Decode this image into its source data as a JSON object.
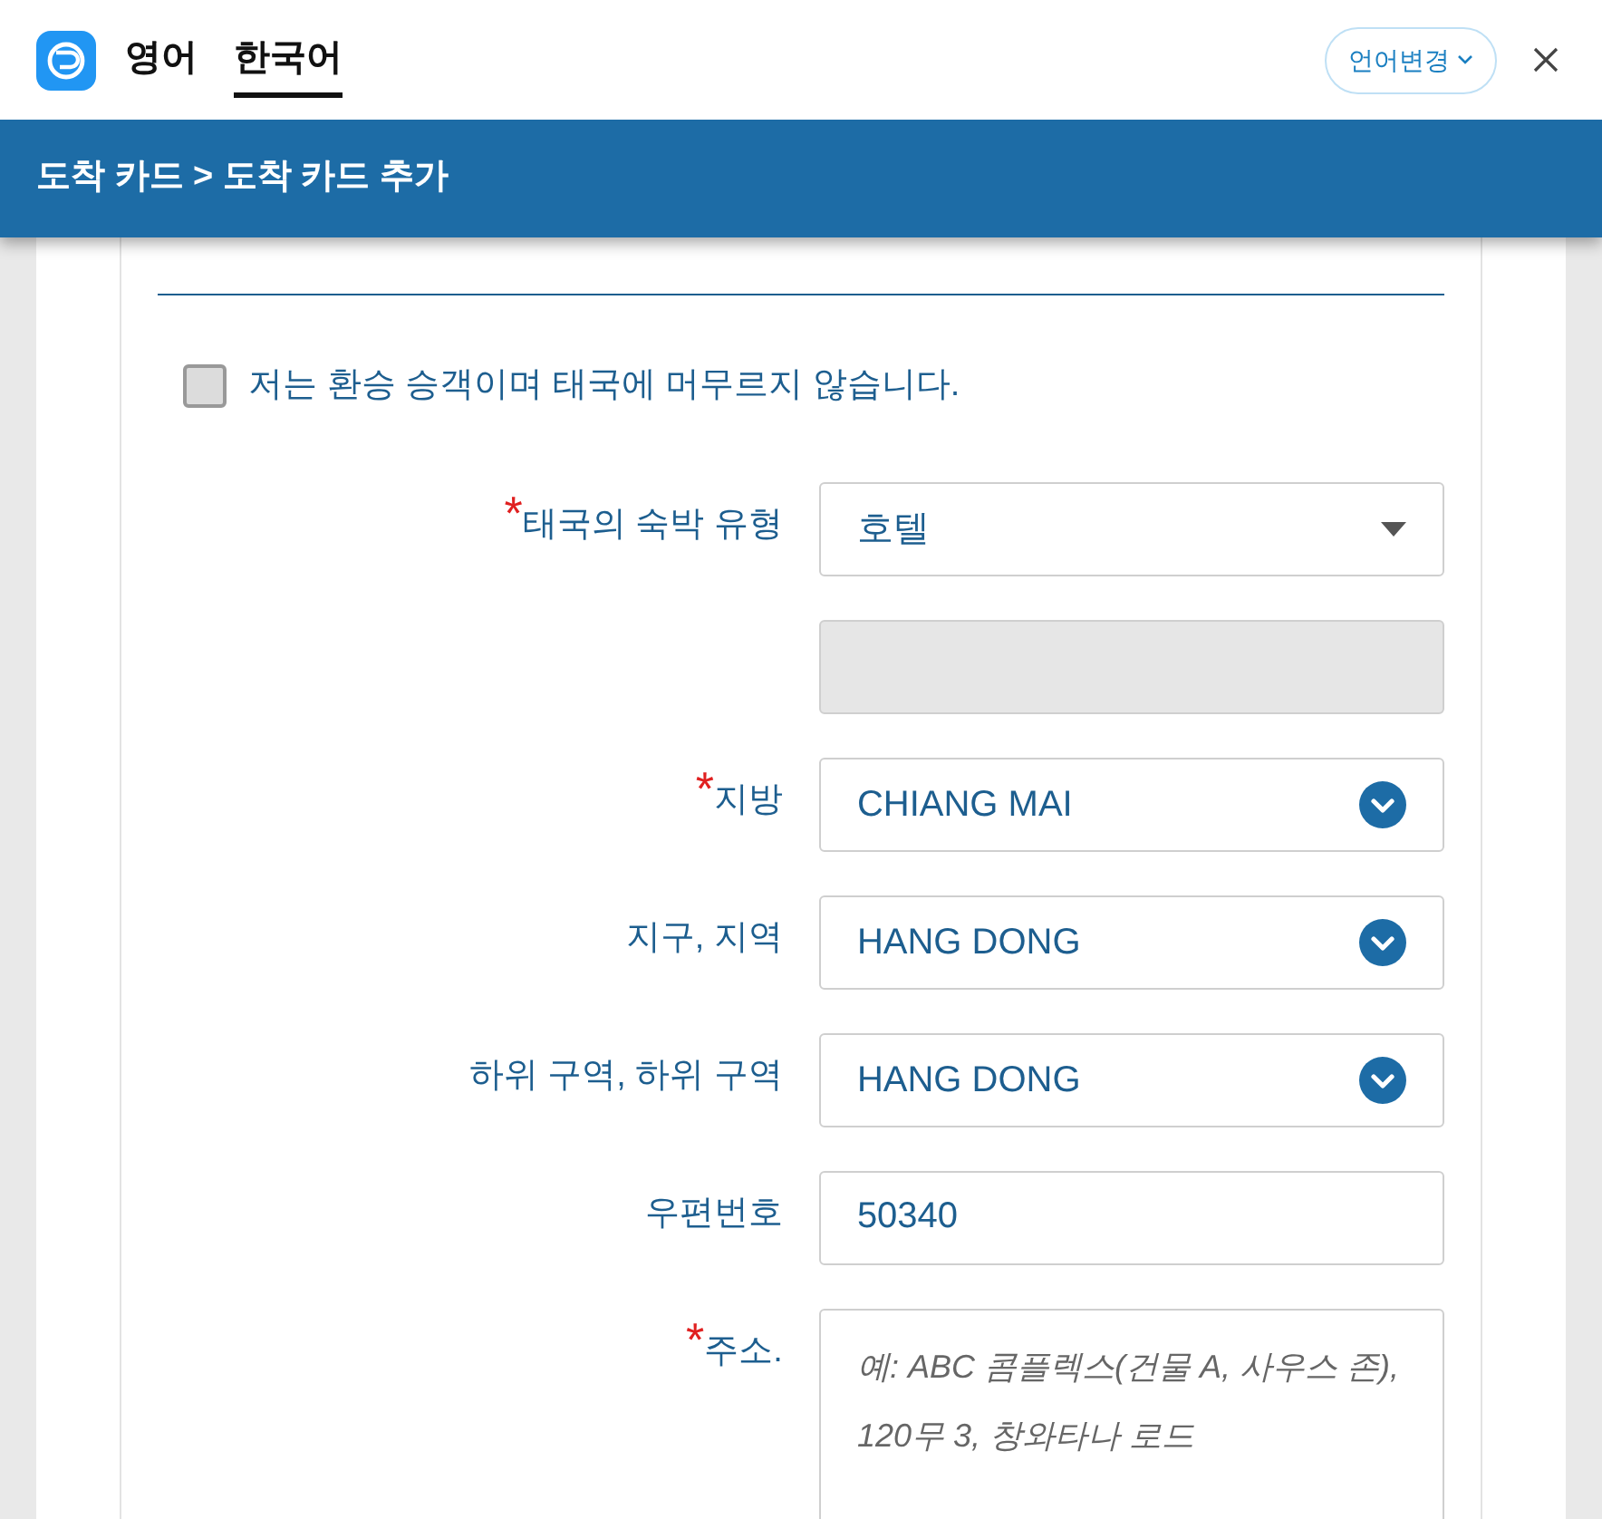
{
  "header": {
    "languages": [
      {
        "label": "영어",
        "selected": false
      },
      {
        "label": "한국어",
        "selected": true
      }
    ],
    "language_button": "언어변경"
  },
  "breadcrumb": "도착 카드 > 도착 카드 추가",
  "transit_checkbox": {
    "label": "저는 환승 승객이며 태국에 머무르지 않습니다.",
    "checked": false
  },
  "fields": [
    {
      "label": "태국의 숙박 유형",
      "required_mark": "*",
      "kind": "select",
      "value": "호텔"
    },
    {
      "kind": "disabled"
    },
    {
      "label": "지방",
      "required_mark": "*",
      "kind": "dropdown",
      "value": "CHIANG MAI"
    },
    {
      "label": "지구, 지역",
      "kind": "dropdown",
      "value": "HANG DONG"
    },
    {
      "label": "하위 구역, 하위 구역",
      "kind": "dropdown",
      "value": "HANG DONG"
    },
    {
      "label": "우편번호",
      "kind": "text",
      "value": "50340"
    },
    {
      "label": "주소.",
      "required_mark": "*",
      "kind": "textarea",
      "placeholder": "예: ABC 콤플렉스(건물 A, 사우스 존), 120무 3, 창와타나 로드"
    }
  ]
}
